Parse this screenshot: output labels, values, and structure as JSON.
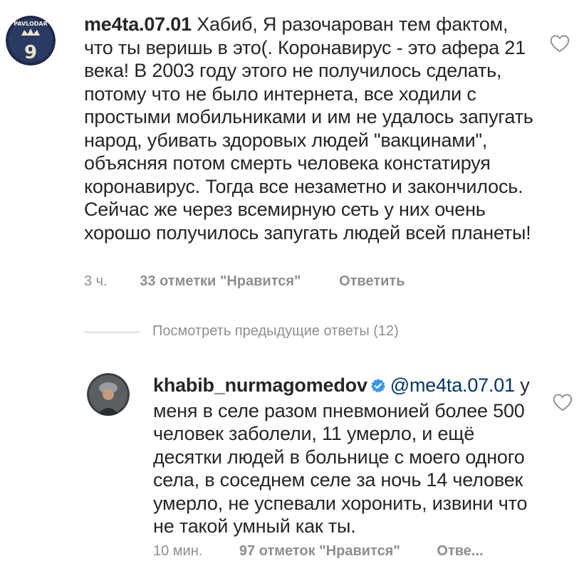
{
  "comment1": {
    "avatar_label": "PAVLODAR",
    "username": "me4ta.07.01",
    "text": "Хабиб, Я разочарован тем фактом, что ты веришь в это(. Коронавирус - это афера 21 века! В 2003 году этого не получилось сделать, потому что не было интернета, все ходили с простыми мобильниками и им не удалось запугать народ, убивать здоровых людей \"вакцинами\", объясняя потом смерть человека констатируя коронавирус. Тогда все незаметно и закончилось. Сейчас же через всемирную сеть у них очень хорошо получилось запугать людей всей планеты!",
    "time": "3 ч.",
    "likes": "33 отметки \"Нравится\"",
    "reply": "Ответить"
  },
  "view_replies": "Посмотреть предыдущие ответы (12)",
  "comment2": {
    "username": "khabib_nurmagomedov",
    "mention": "@me4ta.07.01",
    "text": "у меня в селе разом пневмонией более 500 человек заболели, 11 умерло, и ещё десятки людей в больнице с моего одного села, в соседнем селе за ночь 14 человек умерло, не успевали хоронить, извини что не такой умный как ты.",
    "time": "10 мин.",
    "likes": "97 отметок \"Нравится\"",
    "reply": "Отве..."
  },
  "colors": {
    "text": "#262626",
    "muted": "#8e8e8e",
    "verified": "#3897f0",
    "mention": "#00376b"
  },
  "icons": [
    "heart-icon",
    "verified-badge-icon"
  ]
}
